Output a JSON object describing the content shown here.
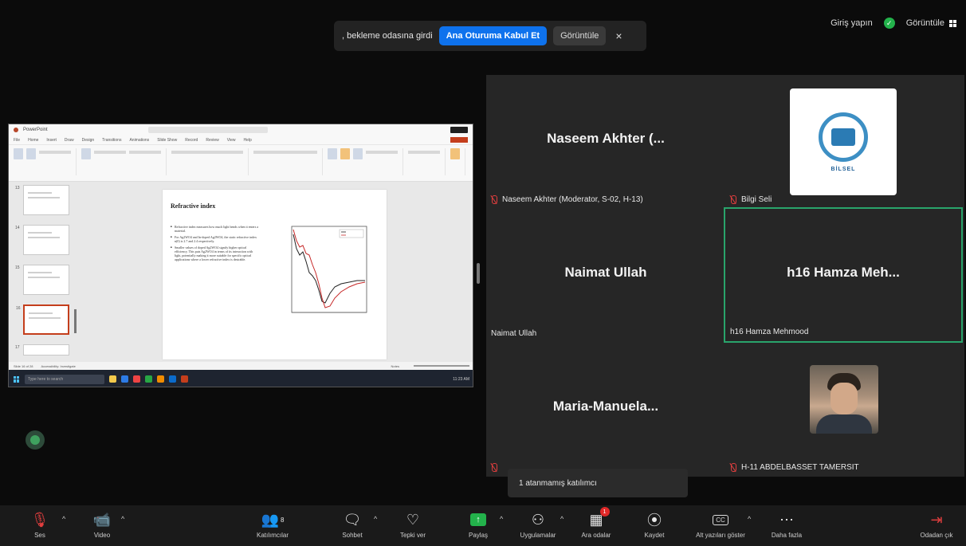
{
  "notification": {
    "message": ", bekleme odasına girdi",
    "admit_label": "Ana Oturuma Kabul Et",
    "view_label": "Görüntüle",
    "close_glyph": "×"
  },
  "topbar": {
    "signin_label": "Giriş yapın",
    "view_label": "Görüntüle"
  },
  "shared_screen": {
    "app_title": "PowerPoint",
    "menu": [
      "File",
      "Home",
      "Insert",
      "Draw",
      "Design",
      "Transitions",
      "Animations",
      "Slide Show",
      "Record",
      "Review",
      "View",
      "Help"
    ],
    "slide_title": "Refractive index",
    "bullets": [
      "Refractive index measures how much light bends when it enters a material.",
      "For Ag2WO4 and In-doped Ag2WO4, the static refractive index n(0) is 2.7 and 2.4 respectively.",
      "Smaller values of doped Ag2WO4 signify higher optical efficiency. This puts Ag2WO4 in terms of its interaction with light, potentially making it more suitable for specific optical applications where a lower refractive index is desirable."
    ],
    "thumb_numbers": [
      "13",
      "14",
      "15",
      "16",
      "17"
    ],
    "status_left": "Slide 16 of 28",
    "status_accessibility": "Accessibility: Investigate",
    "status_notes": "Notes",
    "taskbar_search": "Type here to search",
    "tray_time": "11:23 AM"
  },
  "participants": [
    {
      "display_name": "Naseem Akhter (...",
      "label": "Naseem Akhter (Moderator, S-02, H-13)",
      "muted": true
    },
    {
      "display_name": "",
      "label": "Bilgi Seli",
      "muted": true,
      "logo_text": "BİLSEL"
    },
    {
      "display_name": "Naimat Ullah",
      "label": "Naimat Ullah",
      "muted": false
    },
    {
      "display_name": "h16 Hamza Meh...",
      "label": "h16 Hamza Mehmood",
      "muted": false
    },
    {
      "display_name": "Maria-Manuela...",
      "label": "",
      "muted": true
    },
    {
      "display_name": "",
      "label": "H-11 ABDELBASSET TAMERSIT",
      "muted": true
    }
  ],
  "tooltip": "1 atanmamış katılımcı",
  "toolbar": {
    "audio": "Ses",
    "video": "Video",
    "participants": "Katılımcılar",
    "participants_count": "8",
    "chat": "Sohbet",
    "react": "Tepki ver",
    "share": "Paylaş",
    "apps": "Uygulamalar",
    "breakout": "Ara odalar",
    "breakout_badge": "1",
    "record": "Kaydet",
    "captions": "Alt yazıları göster",
    "more": "Daha fazla",
    "leave": "Odadan çık"
  },
  "colors": {
    "accent_blue": "#0e72ed",
    "active_speaker": "#29a46b",
    "share_green": "#23b24b",
    "muted_red": "#e03e3e"
  }
}
